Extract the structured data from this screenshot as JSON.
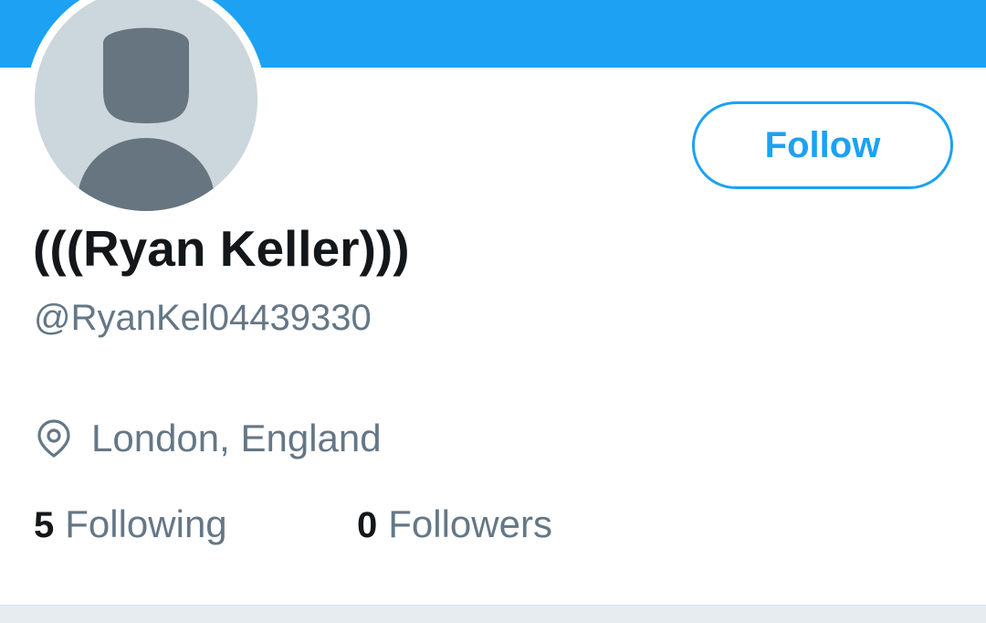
{
  "profile": {
    "display_name": "(((Ryan Keller)))",
    "handle": "@RyanKel04439330",
    "location": "London, England",
    "follow_label": "Follow",
    "avatar_icon": "default-avatar-icon",
    "location_icon": "location-pin-icon"
  },
  "stats": {
    "following_count": "5",
    "following_label": "Following",
    "followers_count": "0",
    "followers_label": "Followers"
  },
  "colors": {
    "accent": "#1da1f2",
    "banner": "#1da1f2",
    "text_primary": "#14171a",
    "text_secondary": "#657786",
    "avatar_bg": "#ccd6dd",
    "avatar_fg": "#66757f"
  }
}
